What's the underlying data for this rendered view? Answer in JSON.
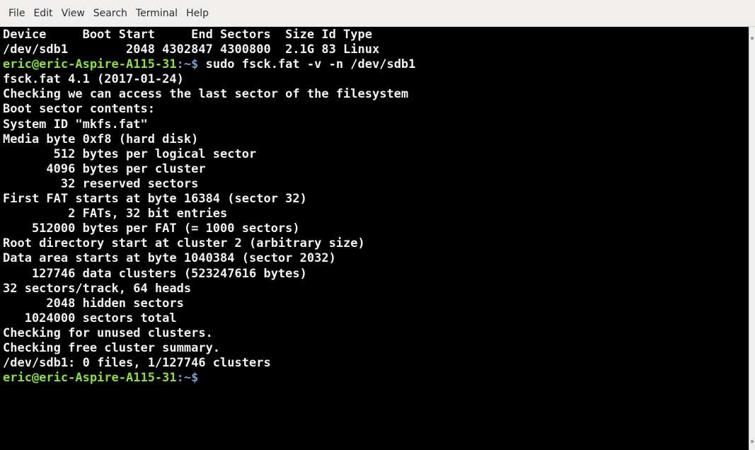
{
  "menubar": {
    "items": [
      "File",
      "Edit",
      "View",
      "Search",
      "Terminal",
      "Help"
    ]
  },
  "terminal": {
    "prompt_user": "eric@eric-Aspire-A115-31",
    "prompt_path": ":~$",
    "command": " sudo fsck.fat -v -n /dev/sdb1",
    "lines_before_prompt": [
      "Device     Boot Start     End Sectors  Size Id Type",
      "/dev/sdb1        2048 4302847 4300800  2.1G 83 Linux"
    ],
    "output_lines": [
      "fsck.fat 4.1 (2017-01-24)",
      "Checking we can access the last sector of the filesystem",
      "Boot sector contents:",
      "System ID \"mkfs.fat\"",
      "Media byte 0xf8 (hard disk)",
      "       512 bytes per logical sector",
      "      4096 bytes per cluster",
      "        32 reserved sectors",
      "First FAT starts at byte 16384 (sector 32)",
      "         2 FATs, 32 bit entries",
      "    512000 bytes per FAT (= 1000 sectors)",
      "Root directory start at cluster 2 (arbitrary size)",
      "Data area starts at byte 1040384 (sector 2032)",
      "    127746 data clusters (523247616 bytes)",
      "32 sectors/track, 64 heads",
      "      2048 hidden sectors",
      "   1024000 sectors total",
      "Checking for unused clusters.",
      "Checking free cluster summary.",
      "/dev/sdb1: 0 files, 1/127746 clusters"
    ],
    "final_prompt_user": "eric@eric-Aspire-A115-31",
    "final_prompt_path": ":~$"
  },
  "colors": {
    "background": "#000000",
    "text": "#f2f2f2",
    "prompt_user": "#8ae234",
    "prompt_path": "#729fcf",
    "menubar": "#f0efee"
  }
}
